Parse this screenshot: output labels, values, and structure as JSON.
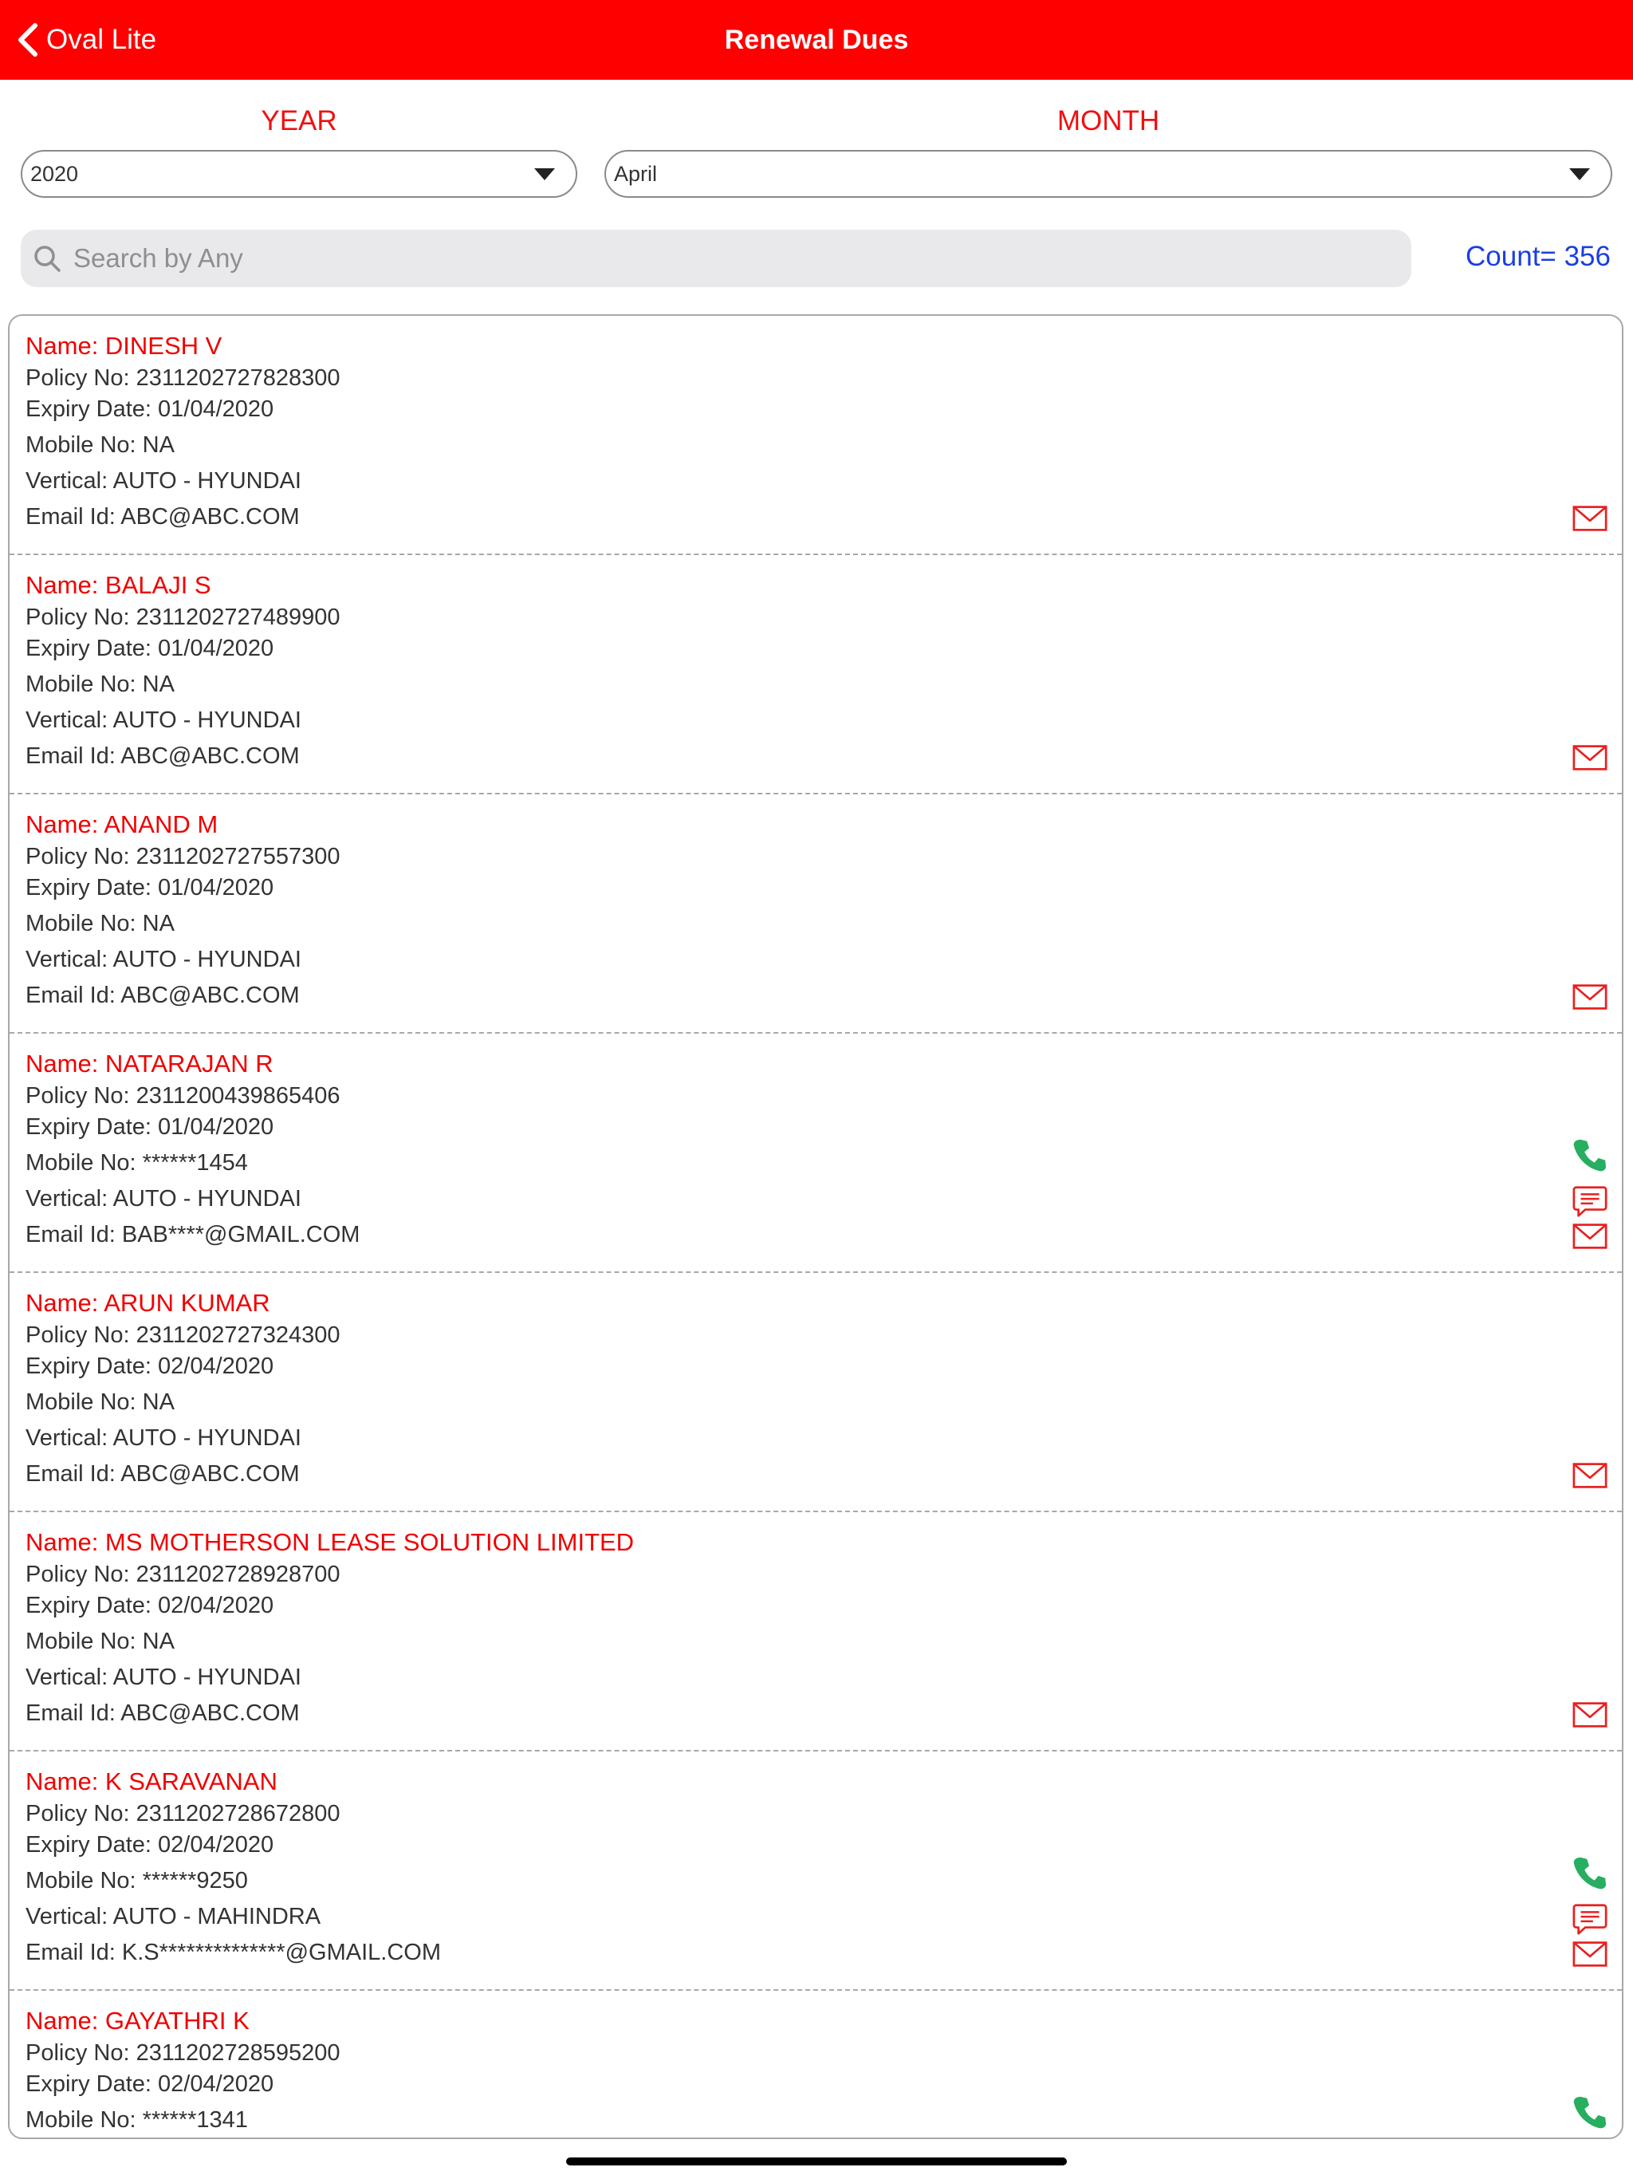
{
  "nav": {
    "back_label": "Oval Lite",
    "title": "Renewal Dues"
  },
  "filters": {
    "year_label": "YEAR",
    "year_value": "2020",
    "month_label": "MONTH",
    "month_value": "April"
  },
  "search": {
    "placeholder": "Search by Any",
    "value": ""
  },
  "count": {
    "text": "Count= 356",
    "value": 356
  },
  "colors": {
    "accent": "#ff0000",
    "name": "#f00000",
    "count": "#1a3fe0",
    "phone": "#27ae60",
    "action": "#e8201f"
  },
  "icons": {
    "back": "chevron-left-icon",
    "search": "magnifier-icon",
    "phone": "phone-icon",
    "sms": "chat-bubble-icon",
    "mail": "envelope-icon",
    "dropdown": "caret-down-icon"
  },
  "records": [
    {
      "name": "Name: DINESH V",
      "policy": "Policy No: 2311202727828300",
      "expiry": "Expiry Date: 01/04/2020",
      "mobile": "Mobile No: NA",
      "vertical": "Vertical: AUTO - HYUNDAI",
      "email": "Email Id: ABC@ABC.COM",
      "can_call": false
    },
    {
      "name": "Name: BALAJI S",
      "policy": "Policy No: 2311202727489900",
      "expiry": "Expiry Date: 01/04/2020",
      "mobile": "Mobile No: NA",
      "vertical": "Vertical: AUTO - HYUNDAI",
      "email": "Email Id: ABC@ABC.COM",
      "can_call": false
    },
    {
      "name": "Name: ANAND M",
      "policy": "Policy No: 2311202727557300",
      "expiry": "Expiry Date: 01/04/2020",
      "mobile": "Mobile No: NA",
      "vertical": "Vertical: AUTO - HYUNDAI",
      "email": "Email Id: ABC@ABC.COM",
      "can_call": false
    },
    {
      "name": "Name: NATARAJAN R",
      "policy": "Policy No: 2311200439865406",
      "expiry": "Expiry Date: 01/04/2020",
      "mobile": "Mobile No: ******1454",
      "vertical": "Vertical: AUTO - HYUNDAI",
      "email": "Email Id: BAB****@GMAIL.COM",
      "can_call": true
    },
    {
      "name": "Name: ARUN KUMAR",
      "policy": "Policy No: 2311202727324300",
      "expiry": "Expiry Date: 02/04/2020",
      "mobile": "Mobile No: NA",
      "vertical": "Vertical: AUTO - HYUNDAI",
      "email": "Email Id: ABC@ABC.COM",
      "can_call": false
    },
    {
      "name": "Name: MS MOTHERSON LEASE SOLUTION LIMITED",
      "policy": "Policy No: 2311202728928700",
      "expiry": "Expiry Date: 02/04/2020",
      "mobile": "Mobile No: NA",
      "vertical": "Vertical: AUTO - HYUNDAI",
      "email": "Email Id: ABC@ABC.COM",
      "can_call": false
    },
    {
      "name": "Name: K SARAVANAN",
      "policy": "Policy No: 2311202728672800",
      "expiry": "Expiry Date: 02/04/2020",
      "mobile": "Mobile No: ******9250",
      "vertical": "Vertical: AUTO - MAHINDRA",
      "email": "Email Id: K.S**************@GMAIL.COM",
      "can_call": true
    },
    {
      "name": "Name: GAYATHRI K",
      "policy": "Policy No: 2311202728595200",
      "expiry": "Expiry Date: 02/04/2020",
      "mobile": "Mobile No: ******1341",
      "vertical": "",
      "email": "",
      "can_call": true
    }
  ]
}
